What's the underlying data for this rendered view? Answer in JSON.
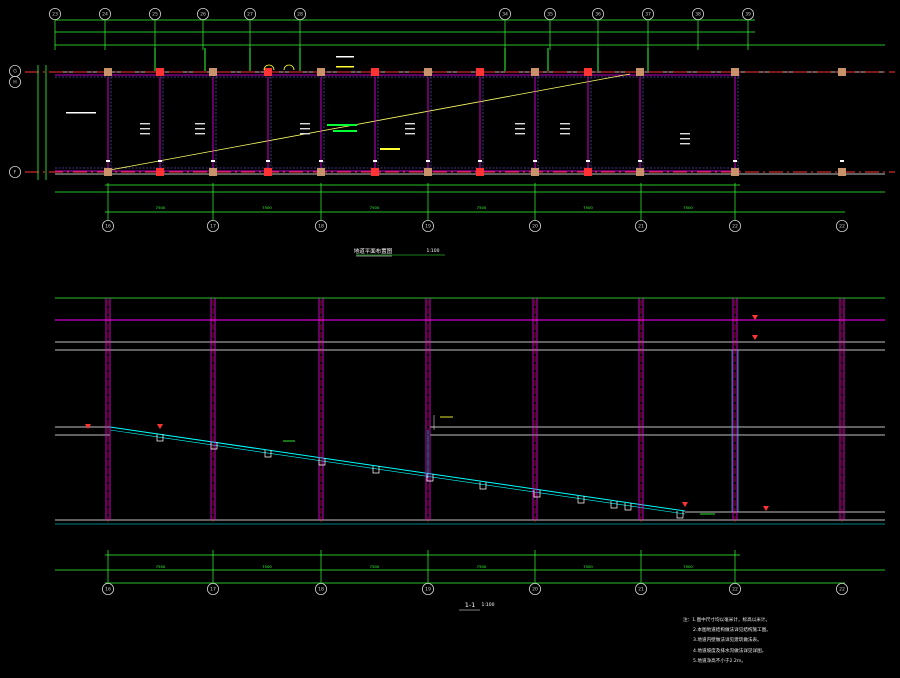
{
  "drawing": {
    "plan_title": "地道平面布置图",
    "plan_scale": "1:100",
    "section_title": "1-1",
    "section_scale": "1:100",
    "colors": {
      "background": "#000000",
      "dimension": "#33ff33",
      "wall": "#ff00ff",
      "axis": "#ff3333",
      "structure": "#ffffff",
      "ramp": "#00ffff",
      "guide": "#ffff66",
      "column": "#c8926a",
      "note_green": "#00ff33",
      "axis_bubble": "#cfcfcf"
    },
    "axes_top": [
      "23",
      "24",
      "25",
      "26",
      "27",
      "28",
      "34",
      "35",
      "36",
      "37",
      "38",
      "39"
    ],
    "axes_left": [
      "G",
      "H",
      "F"
    ],
    "axes_bottom": [
      "16",
      "17",
      "18",
      "19",
      "20",
      "21",
      "22"
    ],
    "plan_bottom_dims": [
      "7500",
      "7500",
      "7500",
      "7500",
      "7500",
      "7500"
    ],
    "section_bottom_dims": [
      "7500",
      "7500",
      "7500",
      "7500",
      "7500",
      "7500"
    ],
    "notes": [
      "注：1.图中尺寸均以毫米计，标高以米计。",
      "2.本图地道结构做法详见结构施工图。",
      "3.地道内壁做法详见建筑做法表。",
      "4.地道坡度及排水沟做法详见详图。",
      "5.地道净高不小于2.2m。"
    ]
  }
}
